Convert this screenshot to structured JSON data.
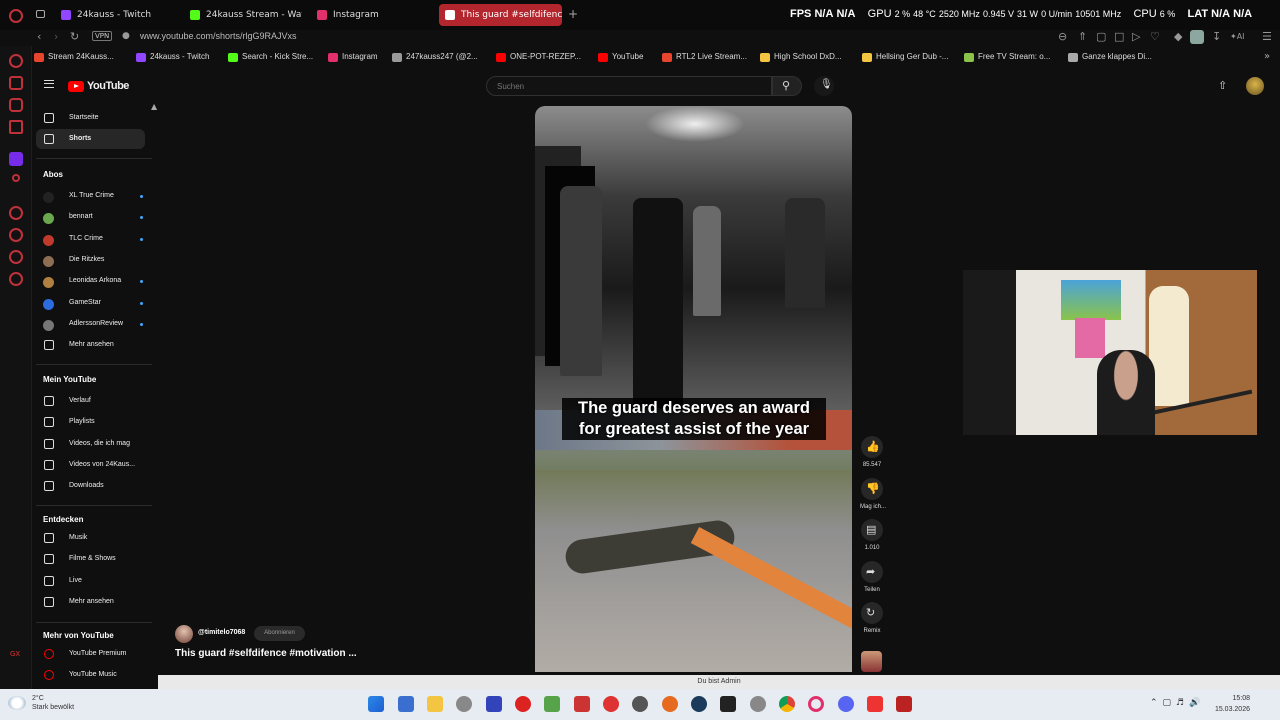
{
  "browser": {
    "tabs": [
      {
        "label": "24kauss - Twitch",
        "color": "#9146ff"
      },
      {
        "label": "24kauss Stream - Wat",
        "color": "#53fc18"
      },
      {
        "label": "Instagram",
        "color": "#e1306c"
      },
      {
        "label": "This guard #selfdifenc",
        "color": "#ff0000"
      }
    ],
    "hud": {
      "fps_label": "FPS",
      "fps_a": "N/A",
      "fps_b": "N/A",
      "gpu_label": "GPU",
      "gpu_load": "2 %",
      "gpu_temp": "48 °C",
      "gpu_clock": "2520 MHz",
      "gpu_volt": "0.945 V",
      "gpu_power": "31 W",
      "gpu_fan": "0 U/min",
      "gpu_mem": "10501 MHz",
      "cpu_label": "CPU",
      "cpu_load": "6 %",
      "lat_label": "LAT",
      "lat_a": "N/A",
      "lat_b": "N/A"
    },
    "vpn_badge": "VPN",
    "url": "www.youtube.com/shorts/rlgG9RAJVxs",
    "bookmarks": [
      {
        "label": "Stream 24Kauss...",
        "color": "#e8442e"
      },
      {
        "label": "24kauss - Twitch",
        "color": "#9146ff"
      },
      {
        "label": "Search - Kick Stre...",
        "color": "#53fc18"
      },
      {
        "label": "Instagram",
        "color": "#e1306c"
      },
      {
        "label": "247kauss247 (@2...",
        "color": "#999999"
      },
      {
        "label": "ONE-POT-REZEP...",
        "color": "#ff0000"
      },
      {
        "label": "YouTube",
        "color": "#ff0000"
      },
      {
        "label": "RTL2 Live Stream...",
        "color": "#e8442e"
      },
      {
        "label": "High School DxD...",
        "color": "#f4c542"
      },
      {
        "label": "Hellsing Ger Dub -...",
        "color": "#f4c542"
      },
      {
        "label": "Free TV Stream: o...",
        "color": "#8bc34a"
      },
      {
        "label": "Ganze klappes Di...",
        "color": "#aaaaaa"
      }
    ]
  },
  "youtube": {
    "logo_text": "YouTube",
    "search_placeholder": "Suchen",
    "sidebar": {
      "main": [
        {
          "label": "Startseite",
          "icon": "home-icon"
        },
        {
          "label": "Shorts",
          "icon": "shorts-icon",
          "active": true
        }
      ],
      "subs_heading": "Abos",
      "subs": [
        {
          "label": "XL True Crime",
          "color": "#222222"
        },
        {
          "label": "bennart",
          "color": "#6aa84f"
        },
        {
          "label": "TLC Crime",
          "color": "#c0392b"
        },
        {
          "label": "Die Ritzkes",
          "color": "#8e6e53"
        },
        {
          "label": "Leonidas Arkona",
          "color": "#b08040"
        },
        {
          "label": "GameStar",
          "color": "#2d6cdf"
        },
        {
          "label": "AdlerssonReview",
          "color": "#777777"
        }
      ],
      "show_more": "Mehr ansehen",
      "you_heading": "Mein YouTube",
      "you": [
        {
          "label": "Verlauf",
          "icon": "history-icon"
        },
        {
          "label": "Playlists",
          "icon": "playlists-icon"
        },
        {
          "label": "Videos, die ich mag",
          "icon": "like-icon"
        },
        {
          "label": "Videos von 24Kaus...",
          "icon": "your-videos-icon"
        },
        {
          "label": "Downloads",
          "icon": "download-icon"
        }
      ],
      "explore_heading": "Entdecken",
      "explore": [
        {
          "label": "Musik",
          "icon": "music-icon"
        },
        {
          "label": "Filme & Shows",
          "icon": "film-icon"
        },
        {
          "label": "Live",
          "icon": "live-icon"
        },
        {
          "label": "Mehr ansehen",
          "icon": "chevron-down-icon"
        }
      ],
      "more_heading": "Mehr von YouTube",
      "more": [
        {
          "label": "YouTube Premium",
          "color": "#ff0000"
        },
        {
          "label": "YouTube Music",
          "color": "#ff0000"
        }
      ]
    },
    "short": {
      "caption_line1": "The guard deserves an award",
      "caption_line2": "for greatest assist of the year",
      "channel": "@timitelo7068",
      "subscribe": "Abonnieren",
      "title": "This guard #selfdifence #motivation ...",
      "actions": {
        "likes": "85.547",
        "dislike": "Mag ich...",
        "comments": "1.010",
        "share": "Teilen",
        "remix": "Remix"
      }
    }
  },
  "status_strip": "Du bist Admin",
  "taskbar": {
    "weather_temp": "2°C",
    "weather_desc": "Stark bewölkt",
    "time": "15:08",
    "date": "15.03.2026"
  }
}
